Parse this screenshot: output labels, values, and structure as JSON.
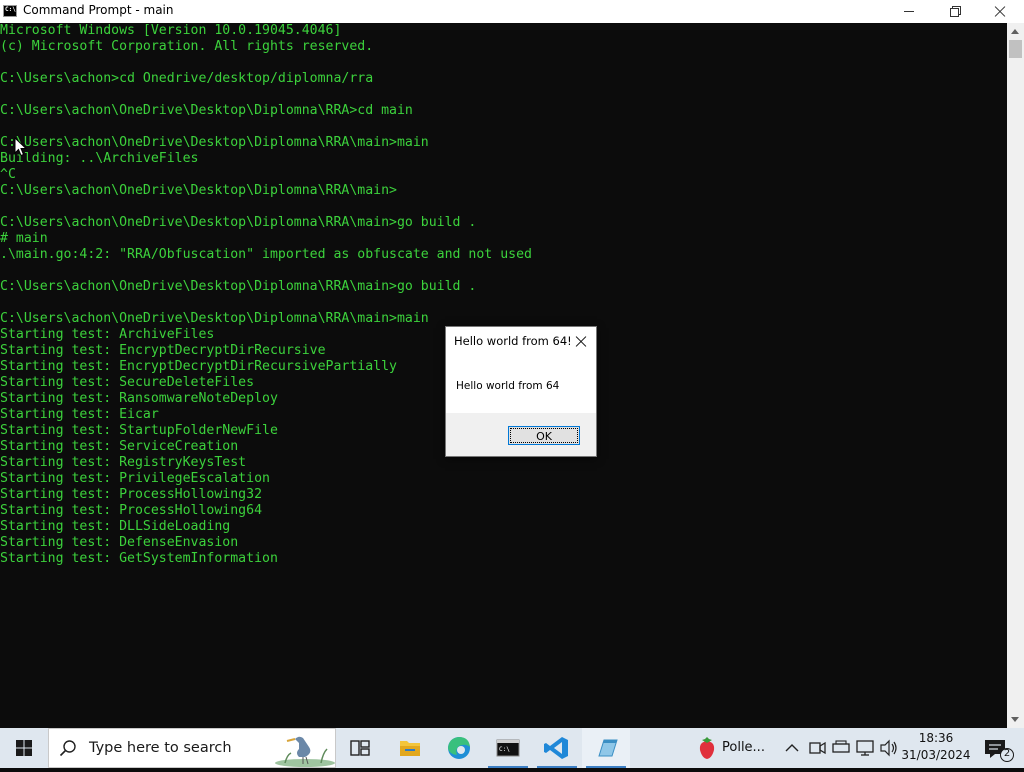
{
  "window": {
    "title": "Command Prompt - main"
  },
  "console": {
    "lines": [
      "Microsoft Windows [Version 10.0.19045.4046]",
      "(c) Microsoft Corporation. All rights reserved.",
      "",
      "C:\\Users\\achon>cd Onedrive/desktop/diplomna/rra",
      "",
      "C:\\Users\\achon\\OneDrive\\Desktop\\Diplomna\\RRA>cd main",
      "",
      "C:\\Users\\achon\\OneDrive\\Desktop\\Diplomna\\RRA\\main>main",
      "Building: ..\\ArchiveFiles",
      "^C",
      "C:\\Users\\achon\\OneDrive\\Desktop\\Diplomna\\RRA\\main>",
      "",
      "C:\\Users\\achon\\OneDrive\\Desktop\\Diplomna\\RRA\\main>go build .",
      "# main",
      ".\\main.go:4:2: \"RRA/Obfuscation\" imported as obfuscate and not used",
      "",
      "C:\\Users\\achon\\OneDrive\\Desktop\\Diplomna\\RRA\\main>go build .",
      "",
      "C:\\Users\\achon\\OneDrive\\Desktop\\Diplomna\\RRA\\main>main",
      "Starting test: ArchiveFiles",
      "Starting test: EncryptDecryptDirRecursive",
      "Starting test: EncryptDecryptDirRecursivePartially",
      "Starting test: SecureDeleteFiles",
      "Starting test: RansomwareNoteDeploy",
      "Starting test: Eicar",
      "Starting test: StartupFolderNewFile",
      "Starting test: ServiceCreation",
      "Starting test: RegistryKeysTest",
      "Starting test: PrivilegeEscalation",
      "Starting test: ProcessHollowing32",
      "Starting test: ProcessHollowing64",
      "Starting test: DLLSideLoading",
      "Starting test: DefenseEnvasion",
      "Starting test: GetSystemInformation"
    ],
    "text_color": "#3cd23c",
    "background": "#0c0c0c"
  },
  "dialog": {
    "title": "Hello world from 64!",
    "message": "Hello world from 64",
    "ok_label": "OK"
  },
  "taskbar": {
    "search_placeholder": "Type here to search",
    "weather_text": "Polle...",
    "time": "18:36",
    "date": "31/03/2024",
    "notification_count": "2",
    "accent": "#3c7fc4"
  }
}
